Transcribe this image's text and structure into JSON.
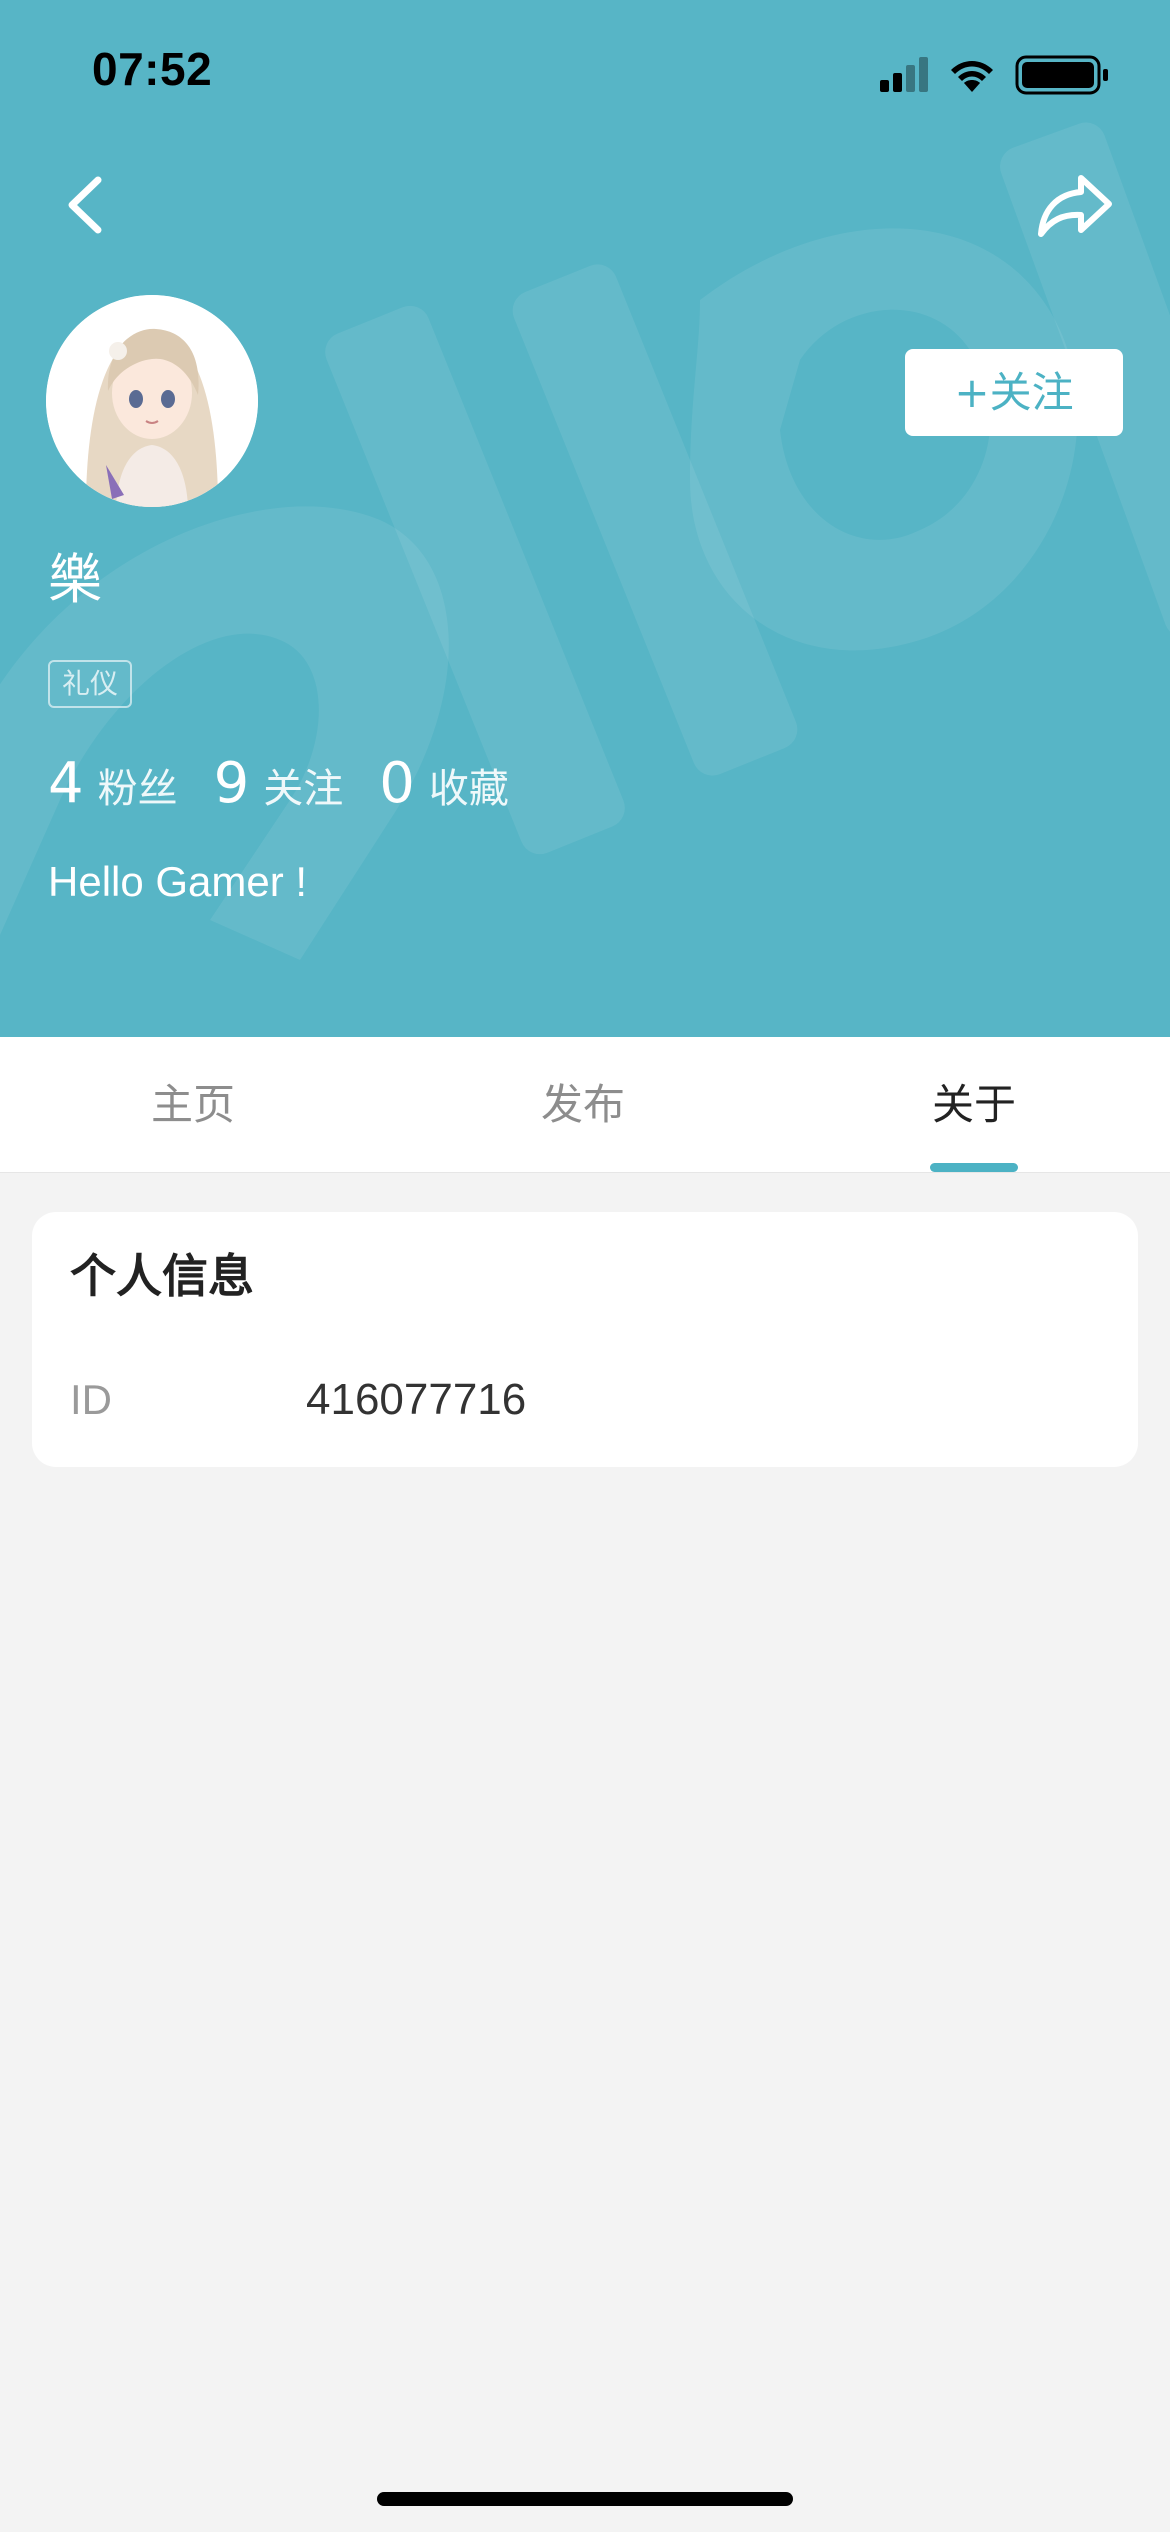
{
  "status_bar": {
    "time": "07:52"
  },
  "profile": {
    "follow_label": "+关注",
    "username": "樂",
    "tag": "礼仪",
    "stats": [
      {
        "count": "4",
        "label": "粉丝"
      },
      {
        "count": "9",
        "label": "关注"
      },
      {
        "count": "0",
        "label": "收藏"
      }
    ],
    "bio": "Hello Gamer !"
  },
  "tabs": [
    {
      "label": "主页",
      "active": false
    },
    {
      "label": "发布",
      "active": false
    },
    {
      "label": "关于",
      "active": true
    }
  ],
  "info_card": {
    "title": "个人信息",
    "rows": [
      {
        "label": "ID",
        "value": "416077716"
      }
    ]
  },
  "icons": {
    "back": "chevron-left-icon",
    "share": "share-arrow-icon",
    "signal": "cellular-signal-icon",
    "wifi": "wifi-icon",
    "battery": "battery-icon"
  },
  "colors": {
    "header_bg": "#57b5c6",
    "accent": "#4cb2c4",
    "page_bg": "#f3f3f3"
  }
}
